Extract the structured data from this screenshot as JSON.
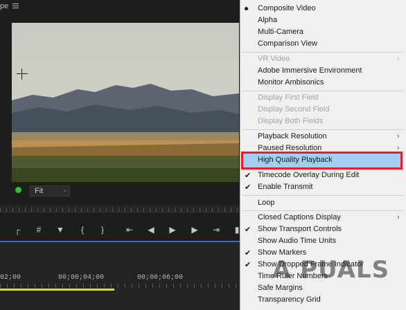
{
  "monitor": {
    "title": "pe",
    "zoom_value": "Fit",
    "timecodes": [
      "02;00",
      "00;00;04;00",
      "00;00;06;00"
    ]
  },
  "menu": {
    "items": [
      {
        "label": "Composite Video",
        "mark": "bullet"
      },
      {
        "label": "Alpha"
      },
      {
        "label": "Multi-Camera"
      },
      {
        "label": "Comparison View"
      },
      {
        "label": "VR Video",
        "disabled": true,
        "submenu": true
      },
      {
        "label": "Adobe Immersive Environment"
      },
      {
        "label": "Monitor Ambisonics"
      },
      {
        "label": "Display First Field",
        "disabled": true
      },
      {
        "label": "Display Second Field",
        "disabled": true
      },
      {
        "label": "Display Both Fields",
        "disabled": true
      },
      {
        "label": "Playback Resolution",
        "submenu": true
      },
      {
        "label": "Paused Resolution",
        "submenu": true
      },
      {
        "label": "High Quality Playback",
        "highlighted": true
      },
      {
        "label": "Timecode Overlay During Edit",
        "mark": "check"
      },
      {
        "label": "Enable Transmit",
        "mark": "check"
      },
      {
        "label": "Loop"
      },
      {
        "label": "Closed Captions Display",
        "submenu": true
      },
      {
        "label": "Show Transport Controls",
        "mark": "check"
      },
      {
        "label": "Show Audio Time Units"
      },
      {
        "label": "Show Markers",
        "mark": "check"
      },
      {
        "label": "Show Dropped Frame Indicator",
        "mark": "check"
      },
      {
        "label": "Time Ruler Numbers"
      },
      {
        "label": "Safe Margins"
      },
      {
        "label": "Transparency Grid"
      }
    ]
  },
  "watermark": "A  PUALS",
  "colors": {
    "highlight_border": "#e3202a",
    "highlight_fill": "#9fd0f2",
    "timeline_blue": "#2f6fd1",
    "work_area": "#e8e000",
    "status_green": "#2fbf3a"
  }
}
